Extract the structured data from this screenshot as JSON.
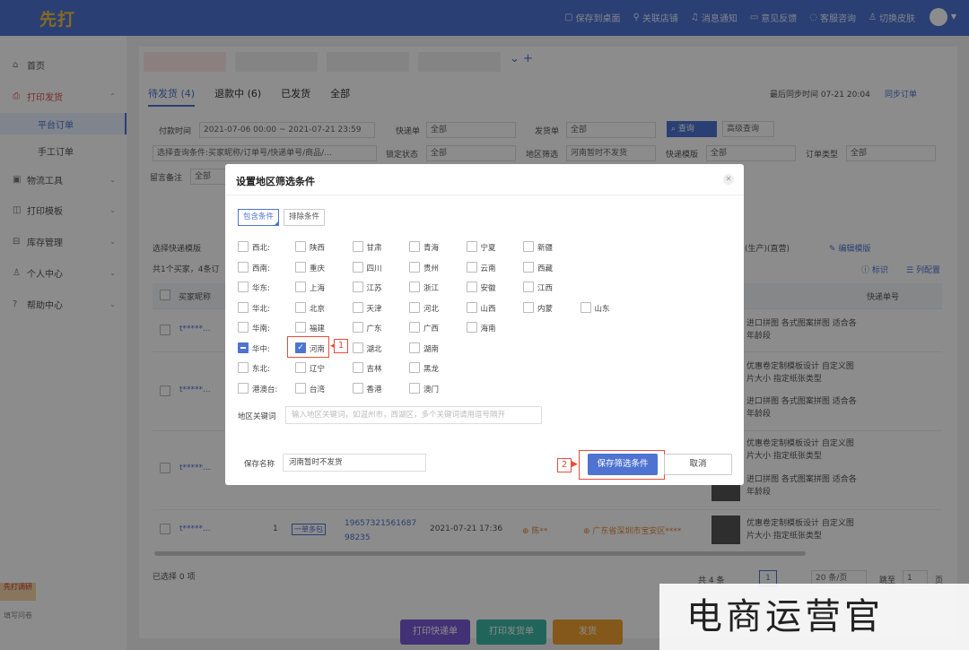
{
  "topbar": {
    "logo": "先打",
    "links": [
      "保存到桌面",
      "关联店铺",
      "消息通知",
      "意见反馈",
      "客服咨询",
      "切换皮肤"
    ]
  },
  "sidebar": {
    "items": [
      {
        "label": "首页",
        "icon": "home-icon"
      },
      {
        "label": "打印发货",
        "icon": "printer-icon"
      },
      {
        "label": "平台订单",
        "icon": ""
      },
      {
        "label": "手工订单",
        "icon": ""
      },
      {
        "label": "物流工具",
        "icon": "truck-icon"
      },
      {
        "label": "打印模板",
        "icon": "template-icon"
      },
      {
        "label": "库存管理",
        "icon": "warehouse-icon"
      },
      {
        "label": "个人中心",
        "icon": "user-icon"
      },
      {
        "label": "帮助中心",
        "icon": "help-icon"
      }
    ],
    "ribbon": "先打调研",
    "survey": "填写问卷"
  },
  "main": {
    "tabs": [
      "待发货 (4)",
      "退款中 (6)",
      "已发货",
      "全部"
    ],
    "sync": "最后同步时间 07-21 20:04",
    "sync_btn": "同步订单",
    "filters": {
      "pay_time_label": "付款时间",
      "pay_time_value": "2021-07-06 00:00 ~ 2021-07-21 23:59",
      "kuaidi_label": "快递单",
      "kuaidi_value": "全部",
      "fahuo_label": "发货单",
      "fahuo_value": "全部",
      "search": "查询",
      "advanced": "高级查询",
      "query_cond": "选择查询条件:买家昵称/订单号/快递单号/商品/...",
      "lock_label": "锁定状态",
      "lock_value": "全部",
      "region_label": "地区筛选",
      "region_value": "河南暂时不发货",
      "tpl_label": "快递模版",
      "tpl_value": "全部",
      "order_type_label": "订单类型",
      "order_type_value": "全部",
      "remark_label": "留言备注",
      "remark_value": "全部"
    },
    "select_tpl": "选择快递模版",
    "buyers": "共1个买家，4条订",
    "edit_tpl": "编辑模版",
    "biaoshi": "标识",
    "col_config": "列配置",
    "col_buyer": "买家昵称",
    "col_express": "快递单号",
    "production": "(生产)(直营)",
    "rows": [
      {
        "buyer": "t*****...",
        "desc": "进口拼图 各式图案拼图 适合各年龄段"
      },
      {
        "buyer": "t*****...",
        "desc": "优惠卷定制模板设计 自定义图片大小 指定纸张类型",
        "desc2": "进口拼图 各式图案拼图 适合各年龄段"
      },
      {
        "buyer": "t*****...",
        "desc": "优惠卷定制模板设计 自定义图片大小 指定纸张类型",
        "desc2": "进口拼图 各式图案拼图 适合各年龄段"
      },
      {
        "buyer": "t*****...",
        "qty": "1",
        "tag": "一单多包",
        "order_no": "1965732156168798235",
        "time": "2021-07-21 17:36",
        "person": "陈**",
        "addr": "广东省深圳市宝安区****",
        "desc": "优惠卷定制模板设计 自定义图片大小 指定纸张类型"
      }
    ],
    "selected": "已选择 0 项",
    "pager": {
      "total": "共 4 条",
      "page": "1",
      "size": "20 条/页",
      "jump": "跳至",
      "jump_val": "1",
      "unit": "页"
    },
    "bottom": [
      "打印快递单",
      "打印发货单",
      "发货"
    ]
  },
  "dialog": {
    "title": "设置地区筛选条件",
    "tab_include": "包含条件",
    "tab_exclude": "排除条件",
    "regions": [
      {
        "group": "西北:",
        "items": [
          "陕西",
          "甘肃",
          "青海",
          "宁夏",
          "新疆"
        ]
      },
      {
        "group": "西南:",
        "items": [
          "重庆",
          "四川",
          "贵州",
          "云南",
          "西藏"
        ]
      },
      {
        "group": "华东:",
        "items": [
          "上海",
          "江苏",
          "浙江",
          "安徽",
          "江西"
        ]
      },
      {
        "group": "华北:",
        "items": [
          "北京",
          "天津",
          "河北",
          "山西",
          "内蒙",
          "山东"
        ]
      },
      {
        "group": "华南:",
        "items": [
          "福建",
          "广东",
          "广西",
          "海南"
        ]
      },
      {
        "group": "华中:",
        "items": [
          "河南",
          "湖北",
          "湖南"
        ]
      },
      {
        "group": "东北:",
        "items": [
          "辽宁",
          "吉林",
          "黑龙"
        ]
      },
      {
        "group": "港澳台:",
        "items": [
          "台湾",
          "香港",
          "澳门"
        ]
      }
    ],
    "checked": "河南",
    "keyword_label": "地区关键词",
    "keyword_placeholder": "输入地区关键词，如温州市，西湖区，多个关键词请用逗号隔开",
    "save_name_label": "保存名称",
    "save_name_value": "河南暂时不发货",
    "save_btn": "保存筛选条件",
    "cancel_btn": "取消",
    "annot1": "1",
    "annot2": "2"
  },
  "watermark": "电商运营官"
}
